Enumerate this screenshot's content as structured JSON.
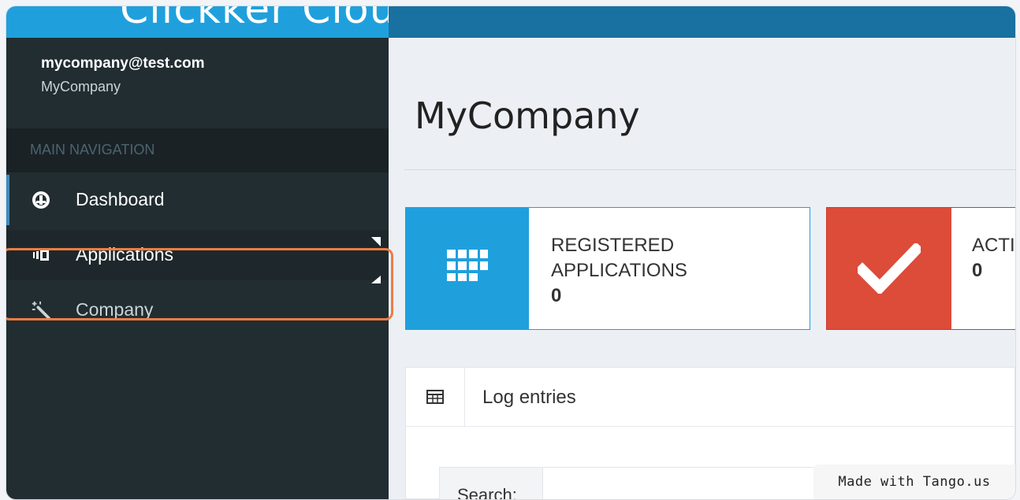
{
  "header": {
    "brand": "Clickker Cloud"
  },
  "user": {
    "email": "mycompany@test.com",
    "company": "MyCompany"
  },
  "sidebar": {
    "section_header": "MAIN NAVIGATION",
    "items": [
      {
        "label": "Dashboard",
        "icon": "dashboard-icon"
      },
      {
        "label": "Applications",
        "icon": "applications-icon"
      },
      {
        "label": "Company",
        "icon": "magic-wand-icon"
      }
    ]
  },
  "main": {
    "title": "MyCompany",
    "info_boxes": [
      {
        "title_line1": "REGISTERED",
        "title_line2": "APPLICATIONS",
        "value": "0",
        "icon": "grid-icon",
        "color": "#1fa0dd"
      },
      {
        "title_line1": "ACTI",
        "value": "0",
        "icon": "check-icon",
        "color": "#dd4b39"
      }
    ],
    "panel": {
      "title": "Log entries",
      "icon": "table-icon",
      "search_label": "Search:"
    }
  },
  "watermark": "Made with Tango.us",
  "colors": {
    "accent": "#1fa0dd",
    "topbar": "#1871a0",
    "sidebar": "#222d32",
    "highlight": "#ee7d44",
    "danger": "#dd4b39"
  }
}
